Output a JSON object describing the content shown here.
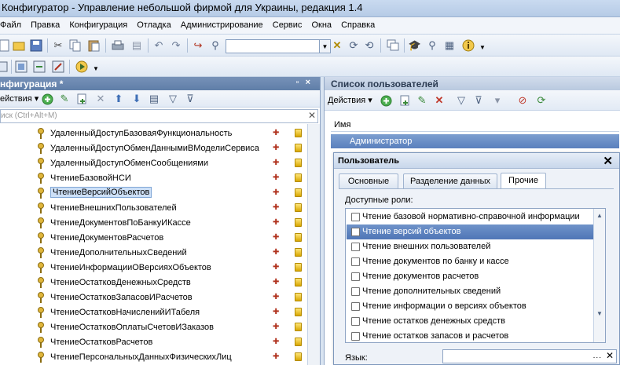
{
  "window": {
    "title": "Конфигуратор - Управление небольшой фирмой для Украины, редакция 1.4"
  },
  "menu": [
    "Файл",
    "Правка",
    "Конфигурация",
    "Отладка",
    "Администрирование",
    "Сервис",
    "Окна",
    "Справка"
  ],
  "left_panel": {
    "title": "нфигурация *",
    "actions_label": "ействия ▾",
    "search_placeholder": "иск (Ctrl+Alt+M)",
    "tree_items": [
      "УдаленныйДоступБазоваяФункциональность",
      "УдаленныйДоступОбменДаннымиВМоделиСервиса",
      "УдаленныйДоступОбменСообщениями",
      "ЧтениеБазовойНСИ",
      "ЧтениеВерсийОбъектов",
      "ЧтениеВнешнихПользователей",
      "ЧтениеДокументовПоБанкуИКассе",
      "ЧтениеДокументовРасчетов",
      "ЧтениеДополнительныхСведений",
      "ЧтениеИнформацииОВерсияхОбъектов",
      "ЧтениеОстатковДенежныхСредств",
      "ЧтениеОстатковЗапасовИРасчетов",
      "ЧтениеОстатковНачисленийИТабеля",
      "ЧтениеОстатковОплатыСчетовИЗаказов",
      "ЧтениеОстатковРасчетов",
      "ЧтениеПерсональныхДанныхФизическихЛиц"
    ],
    "selected_item": "ЧтениеВерсийОбъектов"
  },
  "right_panel": {
    "title": "Список пользователей",
    "actions_label": "Действия ▾",
    "column_name": "Имя",
    "users": [
      "Администратор"
    ]
  },
  "dialog": {
    "title": "Пользователь",
    "tabs": [
      "Основные",
      "Разделение данных",
      "Прочие"
    ],
    "active_tab": "Прочие",
    "roles_label": "Доступные роли:",
    "roles": [
      "Чтение базовой нормативно-справочной информации",
      "Чтение версий объектов",
      "Чтение внешних пользователей",
      "Чтение документов по банку и кассе",
      "Чтение документов расчетов",
      "Чтение дополнительных сведений",
      "Чтение информации о версиях объектов",
      "Чтение остатков денежных средств",
      "Чтение остатков запасов и расчетов"
    ],
    "selected_role": "Чтение версий объектов",
    "language_label": "Язык:",
    "language_value": ""
  },
  "colors": {
    "panel_header": "#6a88b2",
    "selection": "#5a80bd",
    "background": "#d9e4f1"
  },
  "icons": [
    "new-icon",
    "open-icon",
    "save-icon",
    "cut-icon",
    "copy-icon",
    "paste-icon",
    "print-icon",
    "undo-icon",
    "redo-icon",
    "find-icon",
    "clear-icon",
    "run-icon",
    "help-icon"
  ]
}
